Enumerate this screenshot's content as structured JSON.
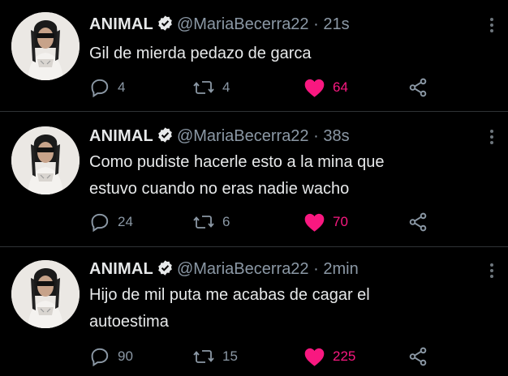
{
  "tweets": [
    {
      "name": "ANIMAL",
      "handle": "@MariaBecerra22",
      "sep": "·",
      "time": "21s",
      "text_lines": [
        "Gil de mierda pedazo de garca"
      ],
      "replies": "4",
      "retweets": "4",
      "likes": "64"
    },
    {
      "name": "ANIMAL",
      "handle": "@MariaBecerra22",
      "sep": "·",
      "time": "38s",
      "text_lines": [
        "Como pudiste hacerle esto a la mina que",
        "estuvo cuando no eras nadie wacho"
      ],
      "replies": "24",
      "retweets": "6",
      "likes": "70"
    },
    {
      "name": "ANIMAL",
      "handle": "@MariaBecerra22",
      "sep": "·",
      "time": "2min",
      "text_lines": [
        "Hijo de mil puta me acabas de cagar el",
        "autoestima"
      ],
      "replies": "90",
      "retweets": "15",
      "likes": "225"
    }
  ],
  "icons": {
    "verified": "verified-badge-icon",
    "more": "more-options-icon",
    "reply": "reply-icon",
    "retweet": "retweet-icon",
    "like": "heart-icon",
    "share": "share-icon"
  },
  "colors": {
    "background": "#000000",
    "text": "#e7e9ea",
    "secondary": "#8b98a5",
    "like": "#f91880",
    "divider": "#2f3336"
  }
}
